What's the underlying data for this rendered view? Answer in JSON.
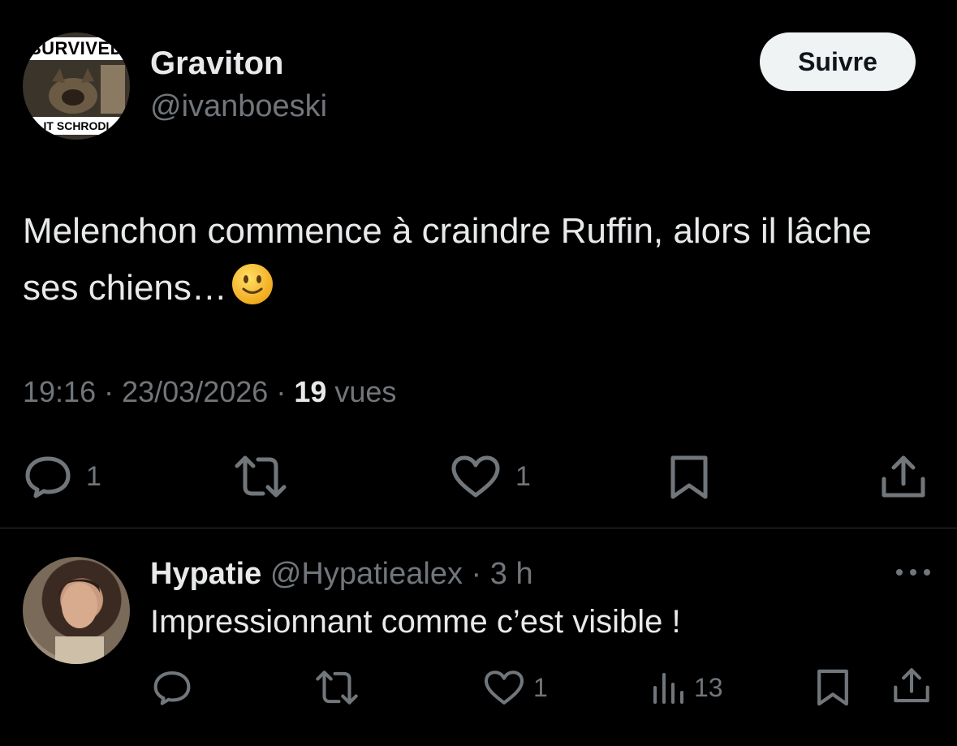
{
  "tweet": {
    "display_name": "Graviton",
    "handle": "@ivanboeski",
    "avatar_text_top": "SURVIVED",
    "avatar_text_bottom": "IT SCHRODI",
    "follow_label": "Suivre",
    "text": "Melenchon commence à craindre Ruffin, alors il lâche ses chiens…",
    "time": "19:16",
    "date": "23/03/2026",
    "views_count": "19",
    "views_label": "vues",
    "actions": {
      "reply_count": "1",
      "like_count": "1"
    }
  },
  "reply": {
    "display_name": "Hypatie",
    "handle": "@Hypatiealex",
    "age": "3 h",
    "text": "Impressionnant comme c’est visible !",
    "actions": {
      "like_count": "1",
      "views_count": "13"
    }
  },
  "icons": {
    "reply": "speech-bubble-icon",
    "retweet": "retweet-icon",
    "like": "heart-icon",
    "bookmark": "bookmark-icon",
    "share": "share-icon",
    "views": "bar-chart-icon",
    "more": "more-dots-icon",
    "emoji": "slightly-smiling-face-emoji"
  },
  "colors": {
    "background": "#000000",
    "text_primary": "#e7e9ea",
    "text_secondary": "#71767b",
    "follow_button_bg": "#eff3f4",
    "divider": "#2f3336"
  }
}
